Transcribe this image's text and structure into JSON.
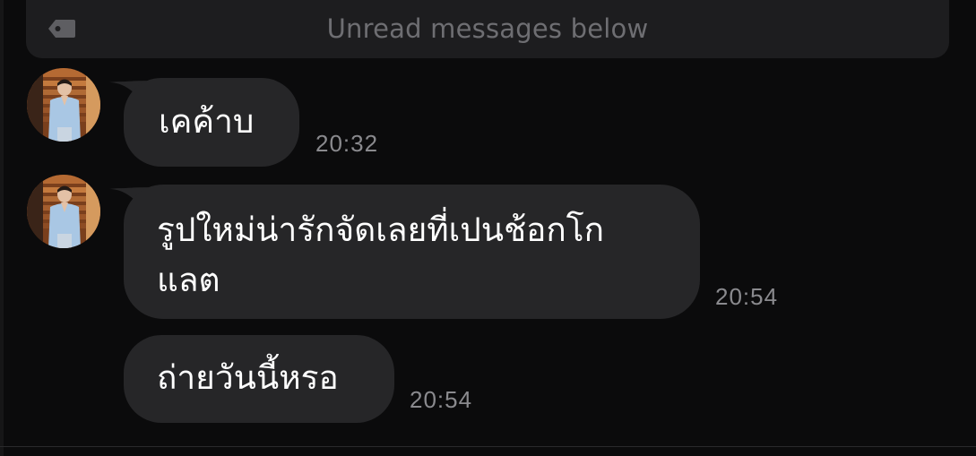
{
  "unread_banner": {
    "icon": "tag-icon",
    "text": "Unread messages below"
  },
  "messages": [
    {
      "text": "เคค้าบ",
      "time": "20:32",
      "avatar": true
    },
    {
      "text": "รูปใหม่น่ารักจัดเลยที่เปนช้อกโกแลต",
      "time": "20:54",
      "avatar": true
    },
    {
      "text": "ถ่ายวันนี้หรอ",
      "time": "20:54",
      "avatar": false
    }
  ],
  "colors": {
    "background": "#0b0b0c",
    "bubble": "#262628",
    "banner": "#1d1d1f",
    "timestamp": "#8a8a8e",
    "banner_text": "#6e6e72"
  }
}
